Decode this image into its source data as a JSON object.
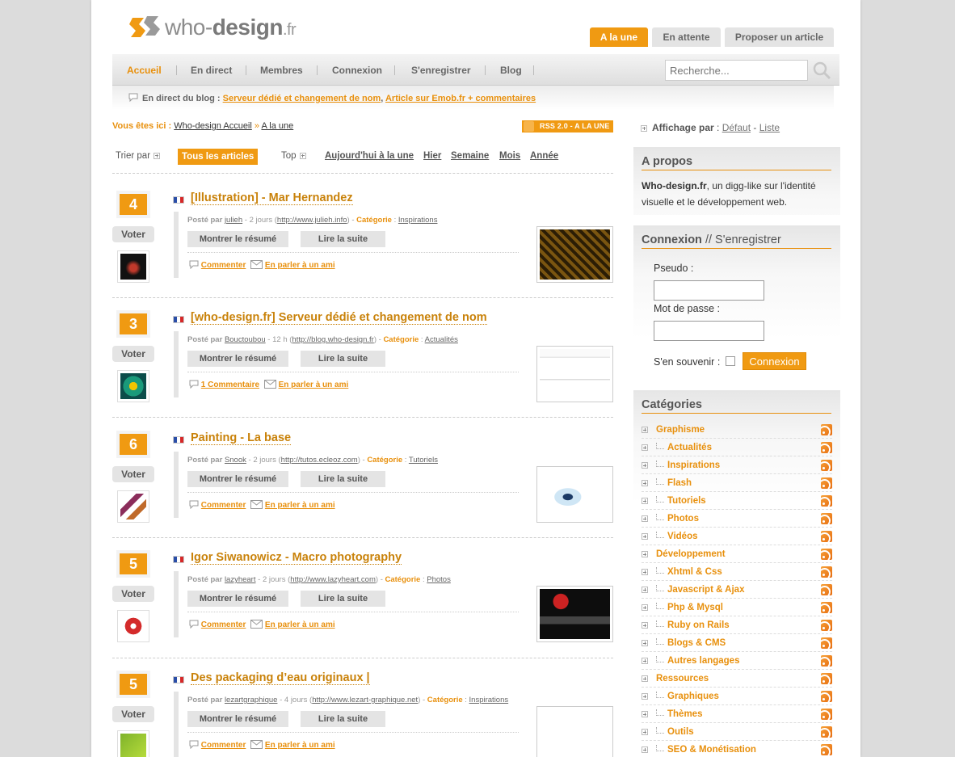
{
  "logo": {
    "text_who": "who-",
    "text_design": "design",
    "text_fr": ".fr"
  },
  "top_tabs": [
    "A la une",
    "En attente",
    "Proposer un article"
  ],
  "nav": {
    "items": [
      "Accueil",
      "En direct",
      "Membres",
      "Connexion",
      "S'enregistrer",
      "Blog"
    ],
    "search_placeholder": "Recherche..."
  },
  "live": {
    "label": "En direct du blog :",
    "link1": "Serveur dédié et changement de nom",
    "sep": ",",
    "link2": "Article sur Emob.fr + commentaires"
  },
  "breadcrumb": {
    "label": "Vous êtes ici :",
    "home": "Who-design Accueil",
    "sep": "»",
    "current": "A la une"
  },
  "rss_label": "RSS 2.0 - A LA UNE",
  "sort": {
    "trier": "Trier par",
    "all": "Tous les articles",
    "top": "Top",
    "options": [
      "Aujourd'hui à la une",
      "Hier",
      "Semaine",
      "Mois",
      "Année"
    ]
  },
  "labels": {
    "voter": "Voter",
    "posted_by": "Posté par",
    "category": "Catégorie",
    "show_summary": "Montrer le résumé",
    "read_more": "Lire la suite",
    "share": "En parler à un ami"
  },
  "articles": [
    {
      "score": "4",
      "title": "[Illustration] - Mar Hernandez",
      "author": "julieh",
      "time": "2 jours",
      "url": "http://www.julieh.info",
      "category": "Inspirations",
      "comments": "Commenter"
    },
    {
      "score": "3",
      "title": "[who-design.fr] Serveur dédié et changement de nom",
      "author": "Bouctoubou",
      "time": "12 h",
      "url": "http://blog.who-design.fr",
      "category": "Actualités",
      "comments": "1 Commentaire"
    },
    {
      "score": "6",
      "title": "Painting - La base",
      "author": "Snook",
      "time": "2 jours",
      "url": "http://tutos.ecleoz.com",
      "category": "Tutoriels",
      "comments": "Commenter"
    },
    {
      "score": "5",
      "title": "Igor Siwanowicz - Macro photography",
      "author": "lazyheart",
      "time": "2 jours",
      "url": "http://www.lazyheart.com",
      "category": "Photos",
      "comments": "Commenter"
    },
    {
      "score": "5",
      "title": "Des packaging d’eau originaux |",
      "author": "lezartgraphique",
      "time": "4 jours",
      "url": "http://www.lezart-graphique.net",
      "category": "Inspirations",
      "comments": "Commenter"
    }
  ],
  "sidebar": {
    "affichage": {
      "label": "Affichage par",
      "opt1": "Défaut",
      "sep": "-",
      "opt2": "Liste"
    },
    "apropos": {
      "title": "A propos",
      "site": "Who-design.fr",
      "text": ", un digg-like sur l'identité visuelle et le développement web."
    },
    "connexion": {
      "title": "Connexion",
      "title_sep": " // ",
      "title2": "S'enregistrer",
      "pseudo": "Pseudo :",
      "password": "Mot de passe :",
      "remember": "S'en souvenir :",
      "button": "Connexion"
    },
    "categories": {
      "title": "Catégories",
      "items": [
        {
          "name": "Graphisme",
          "sub": false
        },
        {
          "name": "Actualités",
          "sub": true
        },
        {
          "name": "Inspirations",
          "sub": true
        },
        {
          "name": "Flash",
          "sub": true
        },
        {
          "name": "Tutoriels",
          "sub": true
        },
        {
          "name": "Photos",
          "sub": true
        },
        {
          "name": "Vidéos",
          "sub": true
        },
        {
          "name": "Développement",
          "sub": false
        },
        {
          "name": "Xhtml & Css",
          "sub": true
        },
        {
          "name": "Javascript & Ajax",
          "sub": true
        },
        {
          "name": "Php & Mysql",
          "sub": true
        },
        {
          "name": "Ruby on Rails",
          "sub": true
        },
        {
          "name": "Blogs & CMS",
          "sub": true
        },
        {
          "name": "Autres langages",
          "sub": true
        },
        {
          "name": "Ressources",
          "sub": false
        },
        {
          "name": "Graphiques",
          "sub": true
        },
        {
          "name": "Thèmes",
          "sub": true
        },
        {
          "name": "Outils",
          "sub": true
        },
        {
          "name": "SEO & Monétisation",
          "sub": true
        }
      ]
    }
  },
  "colors": {
    "accent": "#f09a12",
    "link_orange": "#e8900d",
    "title_orange": "#c9820a"
  }
}
